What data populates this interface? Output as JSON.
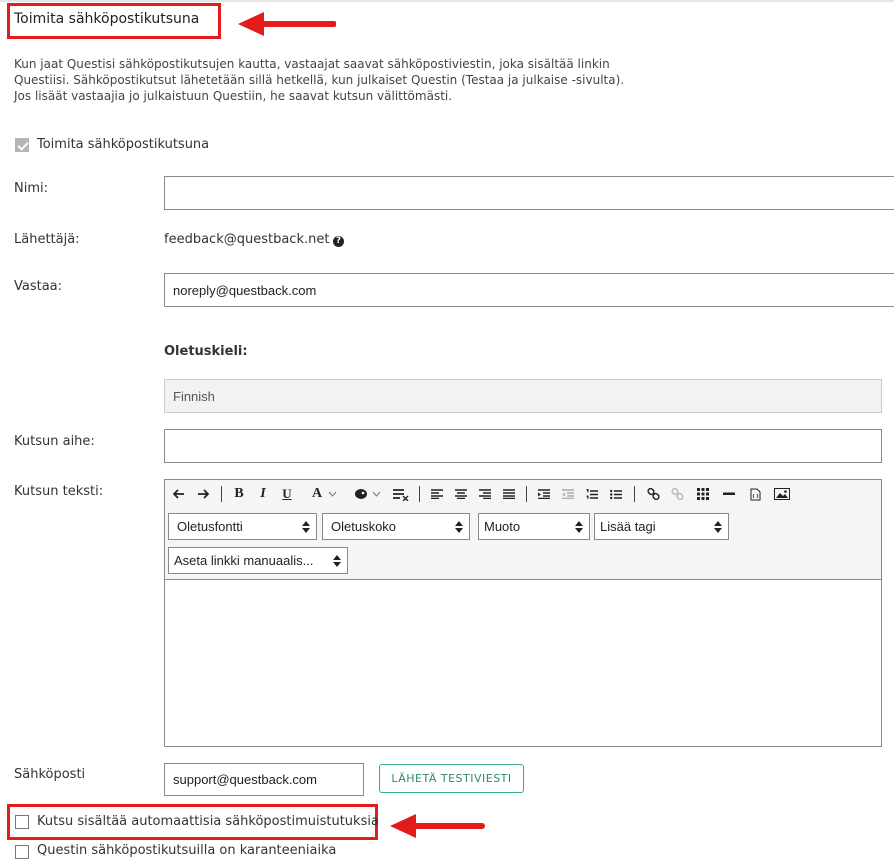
{
  "header": {
    "title": "Toimita sähköpostikutsuna"
  },
  "intro": [
    "Kun jaat Questisi sähköpostikutsujen kautta, vastaajat saavat sähköpostiviestin, joka sisältää linkin",
    "Questiisi. Sähköpostikutsut lähetetään sillä hetkellä, kun julkaiset Questin (Testaa ja julkaise -sivulta).",
    "Jos lisäät vastaajia jo julkaistuun Questiin, he saavat kutsun välittömästi."
  ],
  "deliver_checkbox": {
    "label": "Toimita sähköpostikutsuna",
    "checked": true
  },
  "form": {
    "name_label": "Nimi:",
    "name_value": "",
    "sender_label": "Lähettäjä:",
    "sender_value": "feedback@questback.net",
    "reply_label": "Vastaa:",
    "reply_value": "noreply@questback.com",
    "default_lang_label": "Oletuskieli:",
    "default_lang_value": "Finnish",
    "subject_label": "Kutsun aihe:",
    "subject_value": "",
    "body_label": "Kutsun teksti:",
    "email_label": "Sähköposti",
    "email_value": "support@questback.com",
    "send_test_label": "LÄHETÄ TESTIVIESTI"
  },
  "editor": {
    "bold": "B",
    "italic": "I",
    "underline": "U",
    "font_color": "A",
    "selects": {
      "font": "Oletusfontti",
      "size": "Oletuskoko",
      "format": "Muoto",
      "tag": "Lisää tagi",
      "link": "Aseta linkki manuaalis..."
    }
  },
  "reminders_checkbox": {
    "label": "Kutsu sisältää automaattisia sähköpostimuistutuksia",
    "checked": false
  },
  "quarantine_checkbox": {
    "label": "Questin sähköpostikutsuilla on karanteeniaika",
    "checked": false
  },
  "colors": {
    "annotation": "#e31b1b",
    "accent": "#3aa88a"
  }
}
